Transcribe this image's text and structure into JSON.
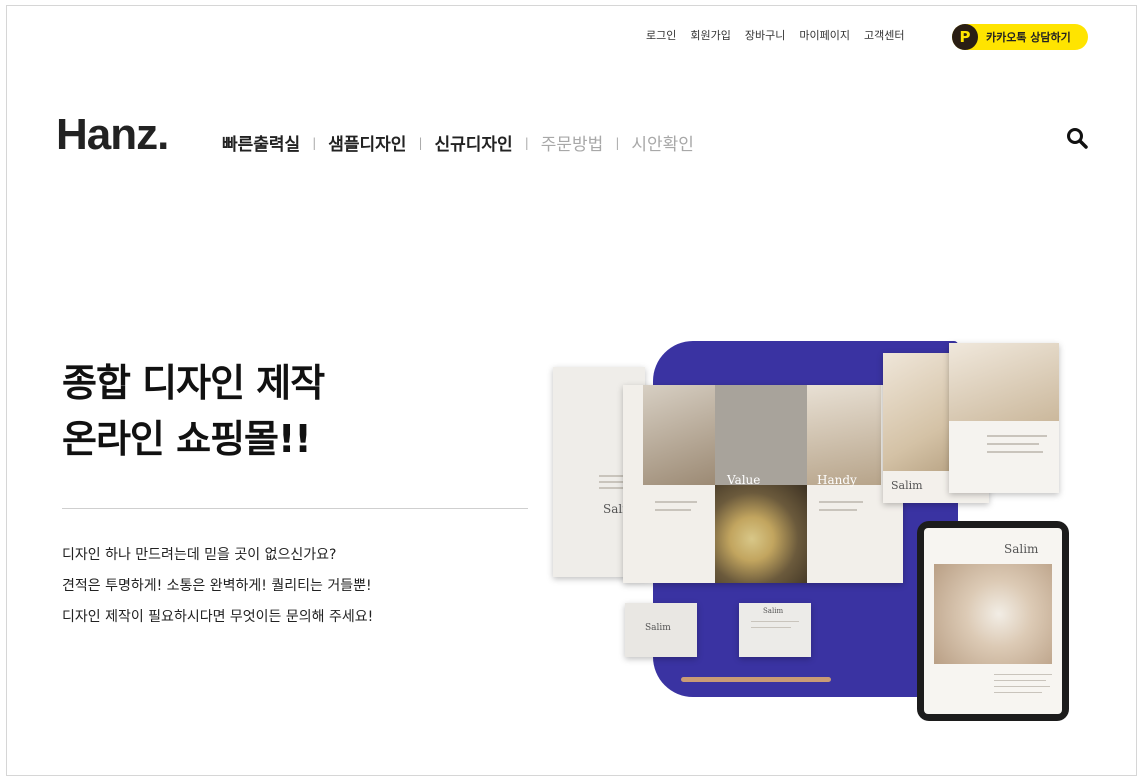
{
  "topbar": {
    "links": [
      "로그인",
      "회원가입",
      "장바구니",
      "마이페이지",
      "고객센터"
    ],
    "kakao_icon": "P",
    "kakao_label": "카카오톡 상담하기"
  },
  "header": {
    "logo": "Hanz.",
    "nav": [
      {
        "label": "빠른출력실",
        "active": true
      },
      {
        "label": "샘플디자인",
        "active": true
      },
      {
        "label": "신규디자인",
        "active": true
      },
      {
        "label": "주문방법",
        "active": false
      },
      {
        "label": "시안확인",
        "active": false
      }
    ],
    "nav_separator": "|",
    "search_icon": "search-icon"
  },
  "hero": {
    "headline_line1": "종합 디자인 제작",
    "headline_line2": "온라인 쇼핑몰!!",
    "desc_line1": "디자인 하나 만드려는데 믿을 곳이 없으신가요?",
    "desc_line2": "견적은 투명하게! 소통은 완벽하게! 퀄리티는 거들뿐!",
    "desc_line3": "디자인 제작이 필요하시다면 무엇이든 문의해 주세요!"
  },
  "mockup": {
    "brand": "Salim",
    "panel_value": "Value",
    "panel_handy": "Handy",
    "colors": {
      "accent": "#3a33a2",
      "kakao": "#ffe400"
    }
  }
}
